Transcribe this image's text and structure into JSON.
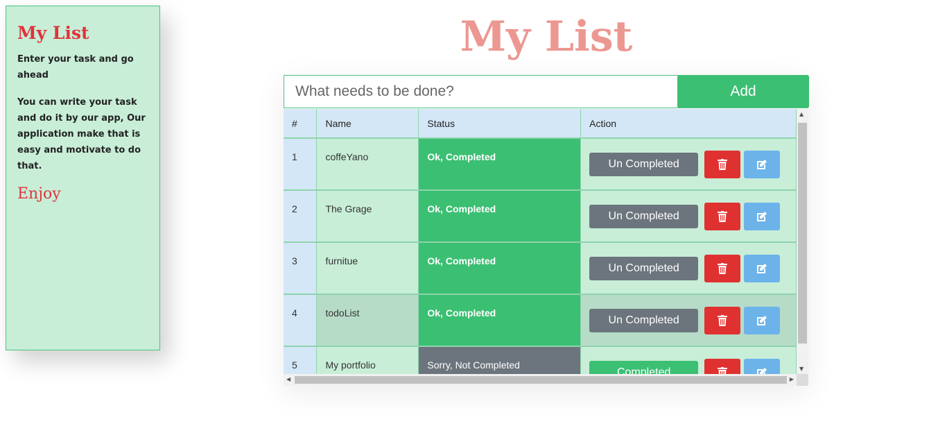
{
  "sidebar": {
    "title": "My List",
    "text1": "Enter your task and go ahead",
    "text2": "You can write your task and do it by our app, Our application make that is easy and motivate to do that.",
    "enjoy": "Enjoy"
  },
  "header": {
    "title": "My List"
  },
  "form": {
    "placeholder": "What needs to be done?",
    "add_label": "Add"
  },
  "table": {
    "headers": [
      "#",
      "Name",
      "Status",
      "Action"
    ],
    "rows": [
      {
        "num": "1",
        "name": "coffeYano",
        "status": "Ok, Completed",
        "toggle": "Un Completed"
      },
      {
        "num": "2",
        "name": "The Grage",
        "status": "Ok, Completed",
        "toggle": "Un Completed"
      },
      {
        "num": "3",
        "name": "furnitue",
        "status": "Ok, Completed",
        "toggle": "Un Completed"
      },
      {
        "num": "4",
        "name": "todoList",
        "status": "Ok, Completed",
        "toggle": "Un Completed"
      },
      {
        "num": "5",
        "name": "My portfolio",
        "status": "Sorry, Not Completed",
        "toggle": "Completed"
      }
    ]
  },
  "icons": {
    "delete": "trash-icon",
    "edit": "edit-icon"
  },
  "colors": {
    "accent": "#3bbf73",
    "title": "#ec9791",
    "sidebar_bg": "#c8eed8",
    "danger": "#e03131",
    "info": "#6cb3ea",
    "gray": "#6c757d"
  }
}
